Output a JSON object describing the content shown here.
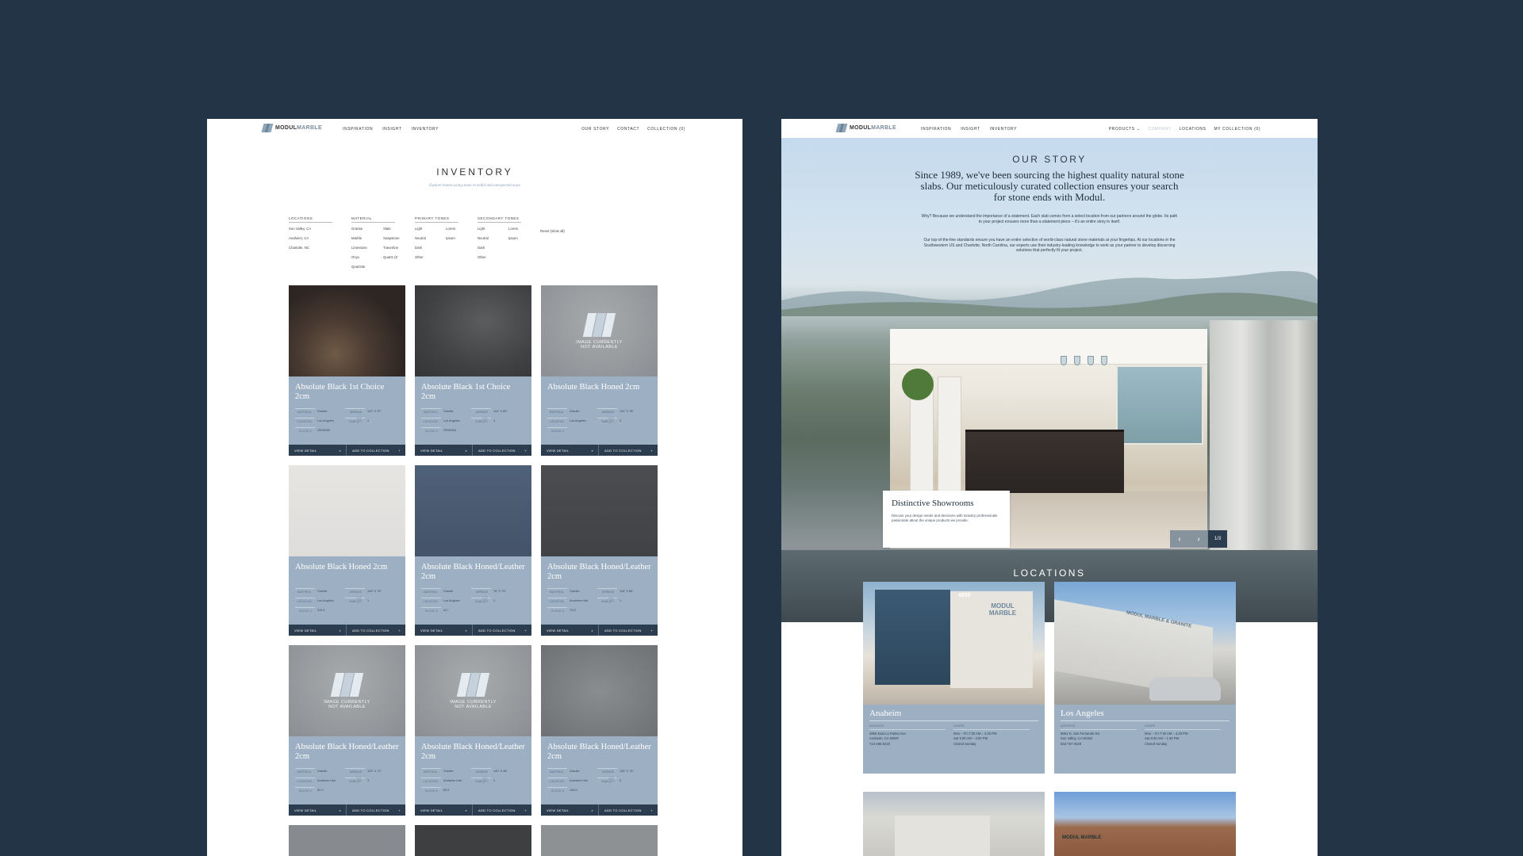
{
  "left_page": {
    "nav": {
      "logo_a": "MODUL",
      "logo_b": "MARBLE",
      "links_left": [
        "INSPIRATION",
        "INSIGHT",
        "INVENTORY"
      ],
      "links_right": [
        "OUR STORY",
        "CONTACT",
        "COLLECTION (0)"
      ]
    },
    "title": "INVENTORY",
    "subtitle": "Explore homes using stone in artful and unexpected ways",
    "filters": {
      "locations": {
        "heading": "LOCATIONS",
        "items": [
          "Sun Valley, CA",
          "Anaheim, CA",
          "Charlotte, NC"
        ]
      },
      "material": {
        "heading": "MATERIAL",
        "items": [
          "Granite",
          "Slate",
          "Marble",
          "Soapstone",
          "Limestone",
          "Travertine",
          "Onyx",
          "Quartz (Z",
          "Quartzite"
        ]
      },
      "primary_tones": {
        "heading": "PRIMARY TONES",
        "items": [
          "Light",
          "Lorem",
          "Neutral",
          "Ipsum",
          "Dark",
          "",
          "Other",
          ""
        ]
      },
      "secondary_tones": {
        "heading": "SECONDARY TONES",
        "items": [
          "Light",
          "Lorem",
          "Neutral",
          "Ipsum",
          "Dark",
          "",
          "Other",
          ""
        ]
      },
      "reset": "Reset (show all)"
    },
    "card_labels": {
      "material": "MATERIAL",
      "location": "LOCATION",
      "block": "BLOCK #",
      "avg_size": "AVERAGE SIZE",
      "slab_qty": "SLAB QTY",
      "view_detail": "VIEW DETAIL",
      "add": "ADD TO COLLECTION",
      "na_text": "IMAGE CURRENTLY NOT AVAILABLE"
    },
    "cards": [
      {
        "name": "Absolute Black 1st Choice 2cm",
        "material": "Granite",
        "location": "Los Angeles",
        "block": "GR09430",
        "size": "112\" X 70\"",
        "qty": "1",
        "img": "brown"
      },
      {
        "name": "Absolute Black 1st Choice 2cm",
        "material": "Granite",
        "location": "Los Angeles",
        "block": "GR09434",
        "size": "114\" X 65\"",
        "qty": "4",
        "img": "dark"
      },
      {
        "name": "Absolute Black Honed 2cm",
        "material": "Granite",
        "location": "Los Angeles",
        "block": "",
        "size": "122\" X 78\"",
        "qty": "3",
        "img": "na"
      },
      {
        "name": "Absolute Black Honed 2cm",
        "material": "Granite",
        "location": "Los Angeles",
        "block": "315 A",
        "size": "126\" X 76\"",
        "qty": "1",
        "img": "white"
      },
      {
        "name": "Absolute Black Honed/Leather 2cm",
        "material": "Granite",
        "location": "Los Angeles",
        "block": "42 I",
        "size": "76\" X 79\"",
        "qty": "1",
        "img": "blue"
      },
      {
        "name": "Absolute Black Honed/Leather 2cm",
        "material": "Granite",
        "location": "Anaheim Hub",
        "block": "75 D",
        "size": "116\" X 68\"",
        "qty": "1",
        "img": "charcoal"
      },
      {
        "name": "Absolute Black Honed/Leather 2cm",
        "material": "Granite",
        "location": "Anaheim Hub",
        "block": "82 C",
        "size": "123\" X 71\"",
        "qty": "3",
        "img": "na"
      },
      {
        "name": "Absolute Black Honed/Leather 2cm",
        "material": "Granite",
        "location": "Anaheim Hub",
        "block": "82 E",
        "size": "120\" X 66\"",
        "qty": "1",
        "img": "na"
      },
      {
        "name": "Absolute Black Honed/Leather 2cm",
        "material": "Granite",
        "location": "Anaheim Hub",
        "block": "105 D",
        "size": "130\" X 79\"",
        "qty": "5",
        "img": "gray"
      }
    ]
  },
  "right_page": {
    "nav": {
      "logo_a": "MODUL",
      "logo_b": "MARBLE",
      "links_left": [
        "INSPIRATION",
        "INSIGHT",
        "INVENTORY"
      ],
      "links_right": [
        "PRODUCTS ⌄",
        "COMPANY",
        "LOCATIONS",
        "MY COLLECTION (0)"
      ]
    },
    "story_title": "OUR STORY",
    "story_headline": "Since 1989, we've been sourcing the highest quality natural stone slabs. Our meticulously curated collection ensures your search for stone ends with Modul.",
    "story_p1": "Why? Because we understand the importance of a statement. Each slab comes from a select location from our partners around the globe. Its path to your project ensures more than a statement piece – it's an entire story in itself.",
    "story_p2": "Our top-of-the-line standards ensure you have an entire selection of world-class natural stone materials at your fingertips. At our locations in the Southwestern US and Charlotte, North Carolina, our experts use their industry-leading knowledge to work as your partner to develop discerning solutions that perfectly fit your project.",
    "showroom": {
      "title": "Distinctive Showrooms",
      "text": "Discuss your design needs and decisions with industry professionals passionate about the unique products we provide.",
      "counter": "1/3"
    },
    "locations_title": "LOCATIONS",
    "location_labels": {
      "address": "ADDRESS",
      "hours": "HOURS"
    },
    "locations": [
      {
        "name": "Anaheim",
        "addr1": "4850 East La Palma Ave.",
        "addr2": "Anaheim, CA 92807",
        "phone": "714-465-5220",
        "h1": "Mon – Fri 7:30 AM – 4:30 PM",
        "h2": "Sat 9:00 AM – 3:00 PM",
        "h3": "Closed Sunday",
        "building_num": "4850"
      },
      {
        "name": "Los Angeles",
        "addr1": "8861 N. San Fernando Rd.",
        "addr2": "Sun Valley, CA 91352",
        "phone": "818-767-4528",
        "h1": "Mon – Fri 7:30 AM – 4:30 PM",
        "h2": "Sat 9:00 AM – 1:30 PM",
        "h3": "Closed Sunday",
        "sign": "MODUL MARBLE & GRANITE"
      }
    ],
    "bottom_sign": "MODUL MARBLE",
    "bldg_logo": "MODUL MARBLE"
  },
  "colors": {
    "background": "#243447",
    "card_body": "#9db0c3",
    "card_footer": "#2c3d50"
  }
}
